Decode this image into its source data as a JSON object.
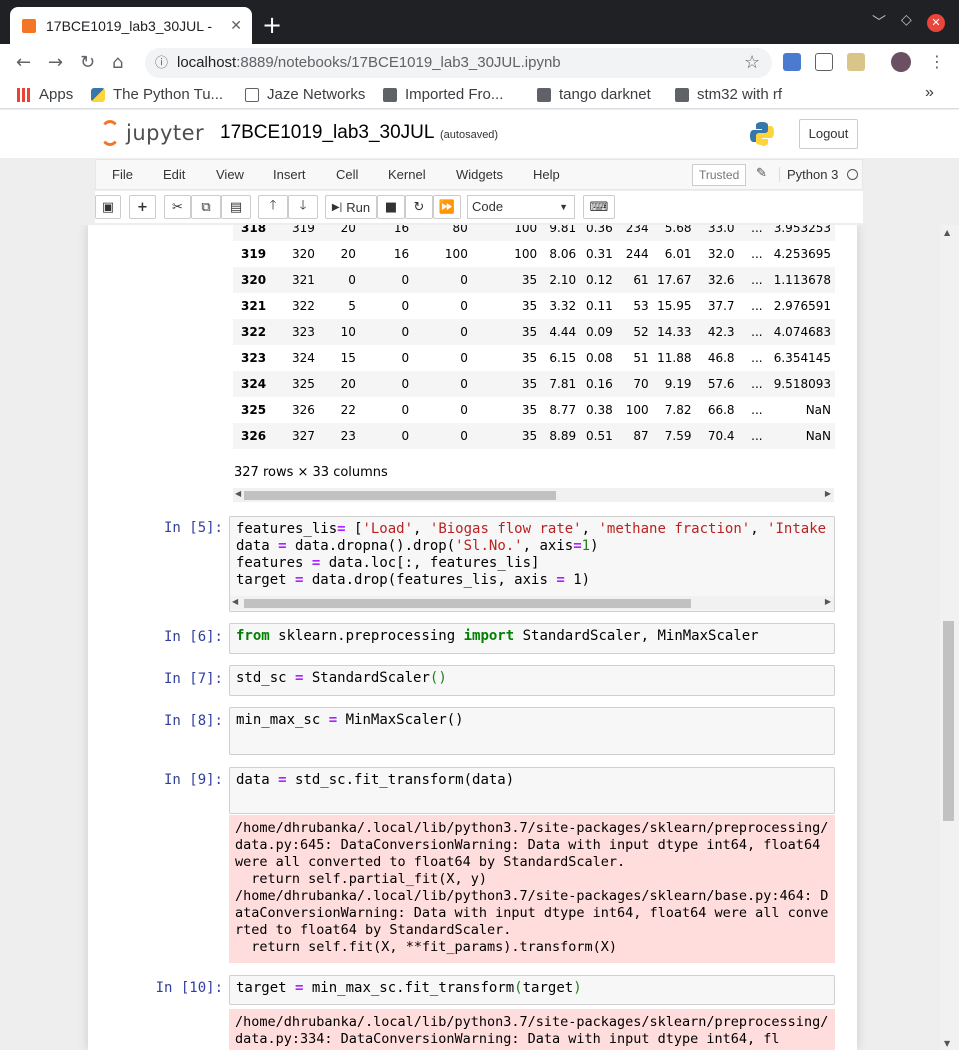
{
  "browser": {
    "tab_title": "17BCE1019_lab3_30JUL - ",
    "tab_close": "✕",
    "new_tab": "+",
    "url_host": "localhost",
    "url_rest": ":8889/notebooks/17BCE1019_lab3_30JUL.ipynb",
    "bookmarks": [
      {
        "label": "Apps",
        "icon": "apps-grid-icon"
      },
      {
        "label": "The Python Tu...",
        "icon": "python-icon"
      },
      {
        "label": "Jaze Networks",
        "icon": "page-icon"
      },
      {
        "label": "Imported Fro...",
        "icon": "folder-icon"
      },
      {
        "label": "tango darknet",
        "icon": "folder-icon"
      },
      {
        "label": "stm32 with rf",
        "icon": "folder-icon"
      }
    ],
    "bookmarks_more": "»"
  },
  "jupyter": {
    "logo_text": "jupyter",
    "notebook_name": "17BCE1019_lab3_30JUL",
    "autosave": "(autosaved)",
    "logout": "Logout",
    "menu": [
      "File",
      "Edit",
      "View",
      "Insert",
      "Cell",
      "Kernel",
      "Widgets",
      "Help"
    ],
    "trusted": "Trusted",
    "kernel": "Python 3",
    "run_label": "Run",
    "cell_type": "Code"
  },
  "dataframe": {
    "rows": [
      [
        "318",
        "319",
        "20",
        "16",
        "80",
        "100",
        "9.81",
        "0.36",
        "234",
        "5.68",
        "33.0",
        "...",
        "3.953253"
      ],
      [
        "319",
        "320",
        "20",
        "16",
        "100",
        "100",
        "8.06",
        "0.31",
        "244",
        "6.01",
        "32.0",
        "...",
        "4.253695"
      ],
      [
        "320",
        "321",
        "0",
        "0",
        "0",
        "35",
        "2.10",
        "0.12",
        "61",
        "17.67",
        "32.6",
        "...",
        "1.113678"
      ],
      [
        "321",
        "322",
        "5",
        "0",
        "0",
        "35",
        "3.32",
        "0.11",
        "53",
        "15.95",
        "37.7",
        "...",
        "2.976591"
      ],
      [
        "322",
        "323",
        "10",
        "0",
        "0",
        "35",
        "4.44",
        "0.09",
        "52",
        "14.33",
        "42.3",
        "...",
        "4.074683"
      ],
      [
        "323",
        "324",
        "15",
        "0",
        "0",
        "35",
        "6.15",
        "0.08",
        "51",
        "11.88",
        "46.8",
        "...",
        "6.354145"
      ],
      [
        "324",
        "325",
        "20",
        "0",
        "0",
        "35",
        "7.81",
        "0.16",
        "70",
        "9.19",
        "57.6",
        "...",
        "9.518093"
      ],
      [
        "325",
        "326",
        "22",
        "0",
        "0",
        "35",
        "8.77",
        "0.38",
        "100",
        "7.82",
        "66.8",
        "...",
        "NaN"
      ],
      [
        "326",
        "327",
        "23",
        "0",
        "0",
        "35",
        "8.89",
        "0.51",
        "87",
        "7.59",
        "70.4",
        "...",
        "NaN"
      ]
    ],
    "shape": "327 rows × 33 columns"
  },
  "cells": {
    "c5": {
      "prompt": "In [5]:"
    },
    "c6": {
      "prompt": "In [6]:"
    },
    "c7": {
      "prompt": "In [7]:"
    },
    "c8": {
      "prompt": "In [8]:"
    },
    "c9": {
      "prompt": "In [9]:",
      "stderr": "/home/dhrubanka/.local/lib/python3.7/site-packages/sklearn/preprocessing/data.py:645: DataConversionWarning: Data with input dtype int64, float64 were all converted to float64 by StandardScaler.\n  return self.partial_fit(X, y)\n/home/dhrubanka/.local/lib/python3.7/site-packages/sklearn/base.py:464: DataConversionWarning: Data with input dtype int64, float64 were all converted to float64 by StandardScaler.\n  return self.fit(X, **fit_params).transform(X)"
    },
    "c10": {
      "prompt": "In [10]:",
      "stderr": "/home/dhrubanka/.local/lib/python3.7/site-packages/sklearn/preprocessing/data.py:334: DataConversionWarning: Data with input dtype int64, fl"
    }
  },
  "code": {
    "t_features_lis": "features_lis",
    "t_eq": "=",
    "t_lb": " [",
    "s_load": "'Load'",
    "s_biogas": "'Biogas flow rate'",
    "s_methane": "'methane fraction'",
    "s_intake": "'Intake",
    "t_comma": ", ",
    "t_data": "data",
    "t_dropna": " data.dropna().drop(",
    "s_slno": "'Sl.No.'",
    "t_axis1": ", axis",
    "t_one": "1",
    "t_rp": ")",
    "t_features": "features",
    "t_loc": " data.loc[:, features_lis]",
    "t_target": "target",
    "t_drop": " data.drop(features_lis, axis ",
    "t_close": " 1)",
    "k_from": "from",
    "t_sklearn": " sklearn.preprocessing ",
    "k_import": "import",
    "t_scalers": " StandardScaler, MinMaxScaler",
    "t_std_sc": "std_sc",
    "t_standardscaler": " StandardScaler",
    "t_parens": "()",
    "t_min_max_sc": "min_max_sc",
    "t_minmaxscaler": " MinMaxScaler()",
    "t_fit_transform_data": " std_sc.fit_transform(data)",
    "t_mm_fit": " min_max_sc.fit_transform",
    "t_lparen": "(",
    "t_target_arg": "target"
  },
  "colors": {
    "jupyter_orange": "#f37626",
    "prompt_blue": "#303f9f",
    "keyword_green": "#008000",
    "string_red": "#ba2121",
    "operator_purple": "#aa22ff",
    "stderr_bg": "#ffdddd"
  }
}
